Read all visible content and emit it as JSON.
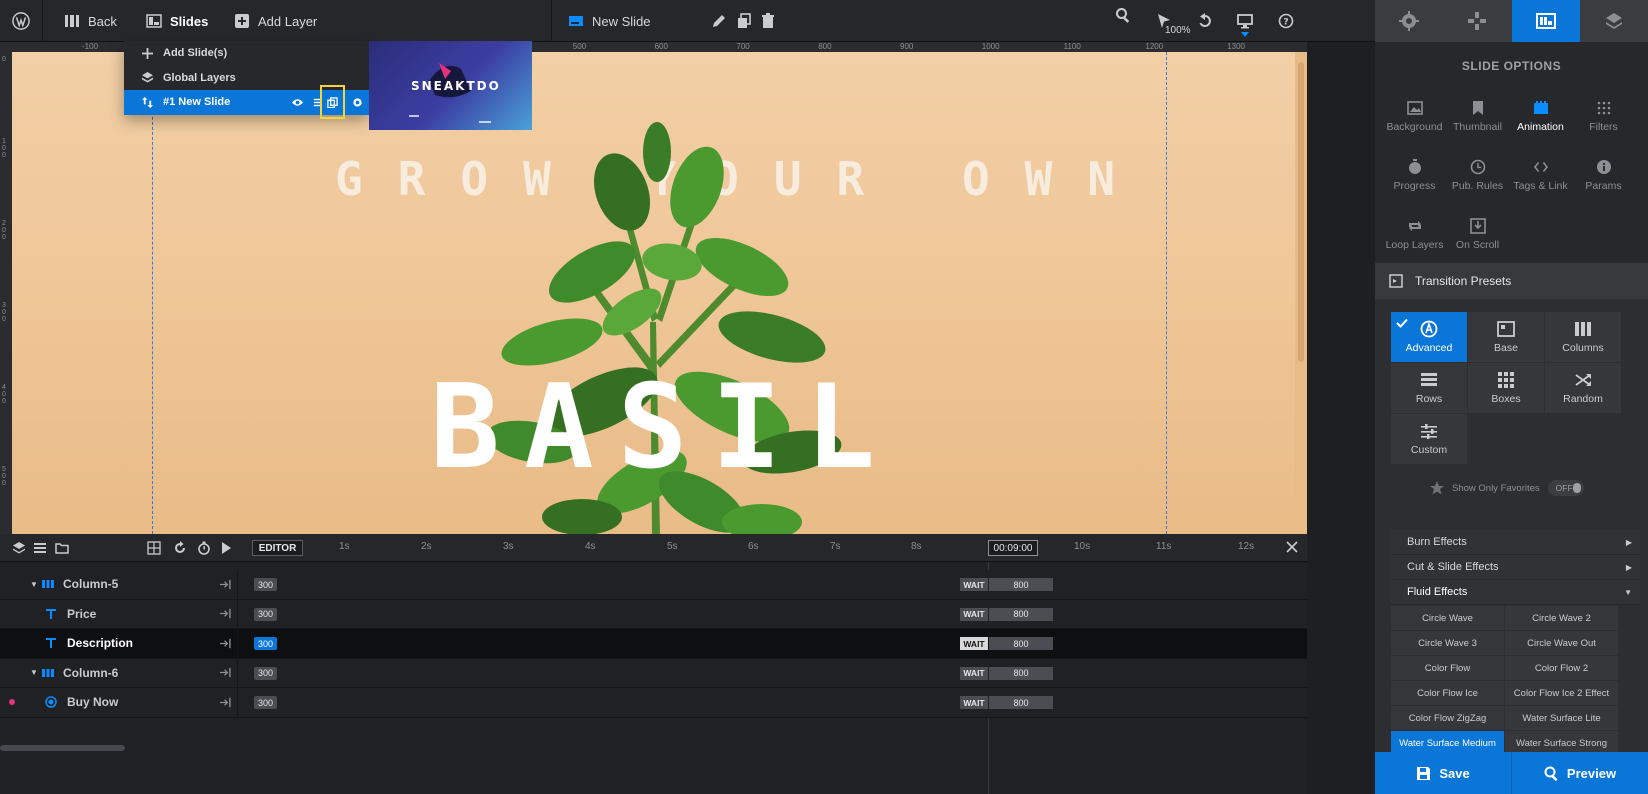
{
  "topbar": {
    "back_label": "Back",
    "slides_label": "Slides",
    "add_layer_label": "Add Layer",
    "slide_name": "New Slide",
    "zoom": "100%"
  },
  "slides_menu": {
    "add_slides": "Add Slide(s)",
    "global_layers": "Global Layers",
    "current_slide": "#1 New Slide",
    "thumbnail_title": "SNEAKTDO"
  },
  "ruler": {
    "h_labels": [
      "-100",
      "",
      "100",
      "200",
      "300",
      "400",
      "500",
      "600",
      "700",
      "800",
      "900",
      "1000",
      "1100",
      "1200",
      "1300",
      "14"
    ],
    "v_labels": [
      "0",
      "100",
      "200",
      "300",
      "400",
      "500"
    ]
  },
  "canvas": {
    "headline": "GROW YOUR OWN",
    "title": "BASIL"
  },
  "sidebar": {
    "title": "SLIDE OPTIONS",
    "options": [
      {
        "label": "Background",
        "icon": "image-icon"
      },
      {
        "label": "Thumbnail",
        "icon": "bookmark-icon"
      },
      {
        "label": "Animation",
        "icon": "film-icon"
      },
      {
        "label": "Filters",
        "icon": "grid-dots-icon"
      },
      {
        "label": "Progress",
        "icon": "stopwatch-icon"
      },
      {
        "label": "Pub. Rules",
        "icon": "clock-icon"
      },
      {
        "label": "Tags & Link",
        "icon": "code-icon"
      },
      {
        "label": "Params",
        "icon": "info-icon"
      },
      {
        "label": "Loop Layers",
        "icon": "loop-icon"
      },
      {
        "label": "On Scroll",
        "icon": "download-icon"
      }
    ],
    "transition_presets_label": "Transition Presets",
    "presets": [
      {
        "label": "Advanced"
      },
      {
        "label": "Base"
      },
      {
        "label": "Columns"
      },
      {
        "label": "Rows"
      },
      {
        "label": "Boxes"
      },
      {
        "label": "Random"
      },
      {
        "label": "Custom"
      }
    ],
    "favorites_label": "Show Only Favorites",
    "favorites_toggle": "OFF",
    "categories": [
      {
        "label": "Burn Effects"
      },
      {
        "label": "Cut & Slide Effects"
      },
      {
        "label": "Fluid Effects"
      }
    ],
    "effects": [
      "Circle Wave",
      "Circle Wave 2",
      "Circle Wave 3",
      "Circle Wave Out",
      "Color Flow",
      "Color Flow 2",
      "Color Flow Ice",
      "Color Flow Ice 2 Effect",
      "Color Flow ZigZag",
      "Water Surface Lite",
      "Water Surface Medium",
      "Water Surface Strong"
    ],
    "save_label": "Save",
    "preview_label": "Preview"
  },
  "timeline": {
    "editor_label": "EDITOR",
    "seconds": [
      "1s",
      "2s",
      "3s",
      "4s",
      "5s",
      "6s",
      "7s",
      "8s",
      "10s",
      "11s",
      "12s"
    ],
    "current_time": "00:09:00",
    "rows": [
      {
        "name": "Column-5",
        "start": "300",
        "wait": "WAIT",
        "end": "800"
      },
      {
        "name": "Price",
        "start": "300",
        "wait": "WAIT",
        "end": "800"
      },
      {
        "name": "Description",
        "start": "300",
        "wait": "WAIT",
        "end": "800"
      },
      {
        "name": "Column-6",
        "start": "300",
        "wait": "WAIT",
        "end": "800"
      },
      {
        "name": "Buy Now",
        "start": "300",
        "wait": "WAIT",
        "end": "800"
      }
    ]
  },
  "colors": {
    "accent": "#0a76d8",
    "canvas_bg": "#efc697",
    "highlight": "#f3d43a"
  }
}
